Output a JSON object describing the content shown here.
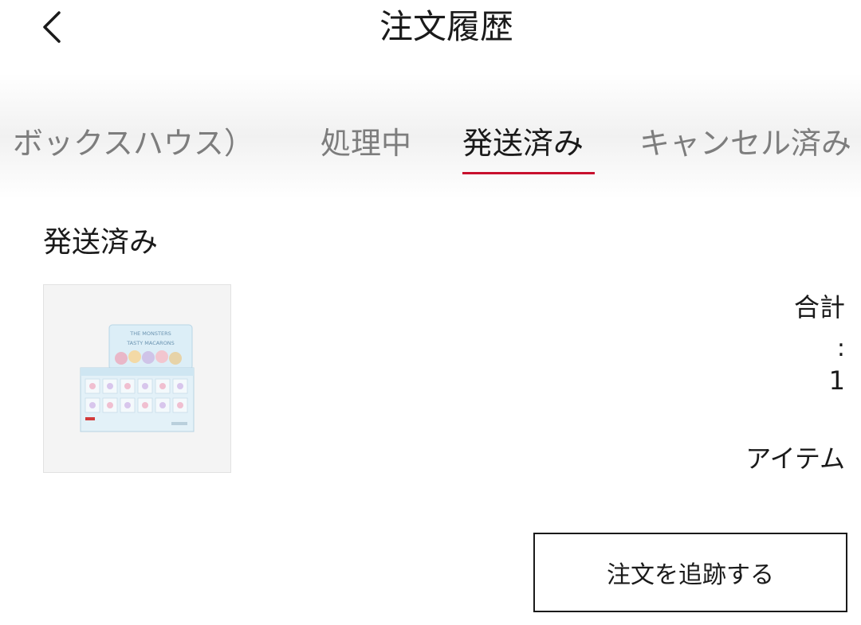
{
  "header": {
    "title": "注文履歴",
    "back_icon": "chevron-left-icon"
  },
  "tabs": [
    {
      "label": "ボックスハウス）",
      "active": false
    },
    {
      "label": "処理中",
      "active": false
    },
    {
      "label": "発送済み",
      "active": true
    },
    {
      "label": "キャンセル済み",
      "active": false
    }
  ],
  "accent_color": "#c8102e",
  "order": {
    "status": "発送済み",
    "thumbnail": {
      "caption_line1": "THE MONSTERS",
      "caption_line2": "TASTY MACARONS"
    },
    "summary": {
      "total_label": "合計",
      "colon": ":",
      "count": "1",
      "unit": "アイテム"
    },
    "track_button": "注文を追跡する"
  }
}
